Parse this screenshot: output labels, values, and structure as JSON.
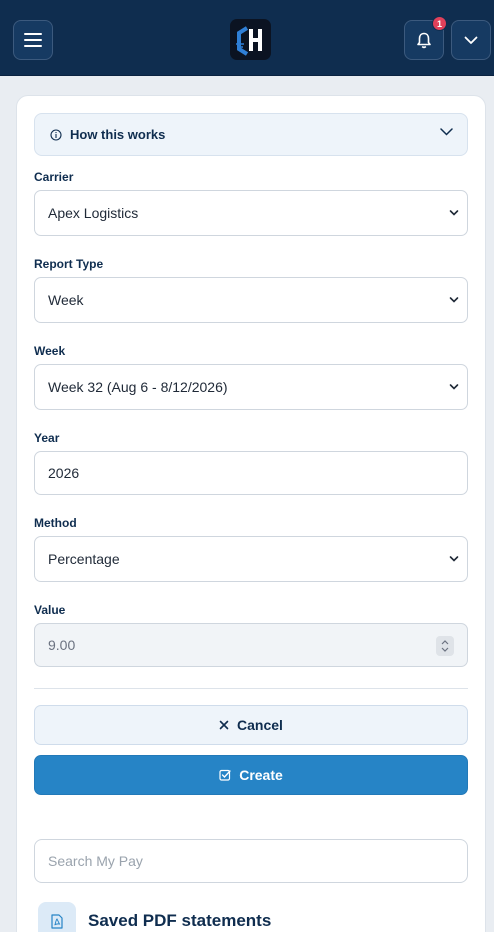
{
  "header": {
    "notification_count": "1",
    "logo_letter": "H"
  },
  "how_it_works": {
    "title": "How this works"
  },
  "form": {
    "carrier": {
      "label": "Carrier",
      "value": "Apex Logistics"
    },
    "report_type": {
      "label": "Report Type",
      "value": "Week"
    },
    "week": {
      "label": "Week",
      "value": "Week 32 (Aug 6 - 8/12/2026)"
    },
    "year": {
      "label": "Year",
      "value": "2026"
    },
    "method": {
      "label": "Method",
      "value": "Percentage"
    },
    "value": {
      "label": "Value",
      "value": "9.00"
    }
  },
  "actions": {
    "cancel_label": "Cancel",
    "create_label": "Create"
  },
  "search": {
    "placeholder": "Search My Pay"
  },
  "saved_section": {
    "title": "Saved PDF statements"
  },
  "icons": {
    "menu": "hamburger-menu-icon",
    "bell": "bell-icon",
    "chevron": "chevron-down-icon",
    "info": "info-icon",
    "close": "x-icon",
    "check": "check-square-icon",
    "pdf": "pdf-file-icon"
  },
  "colors": {
    "header_bg": "#0f2d4f",
    "primary": "#2684c6",
    "badge": "#e0405a",
    "text_dark": "#0f2d4f"
  }
}
